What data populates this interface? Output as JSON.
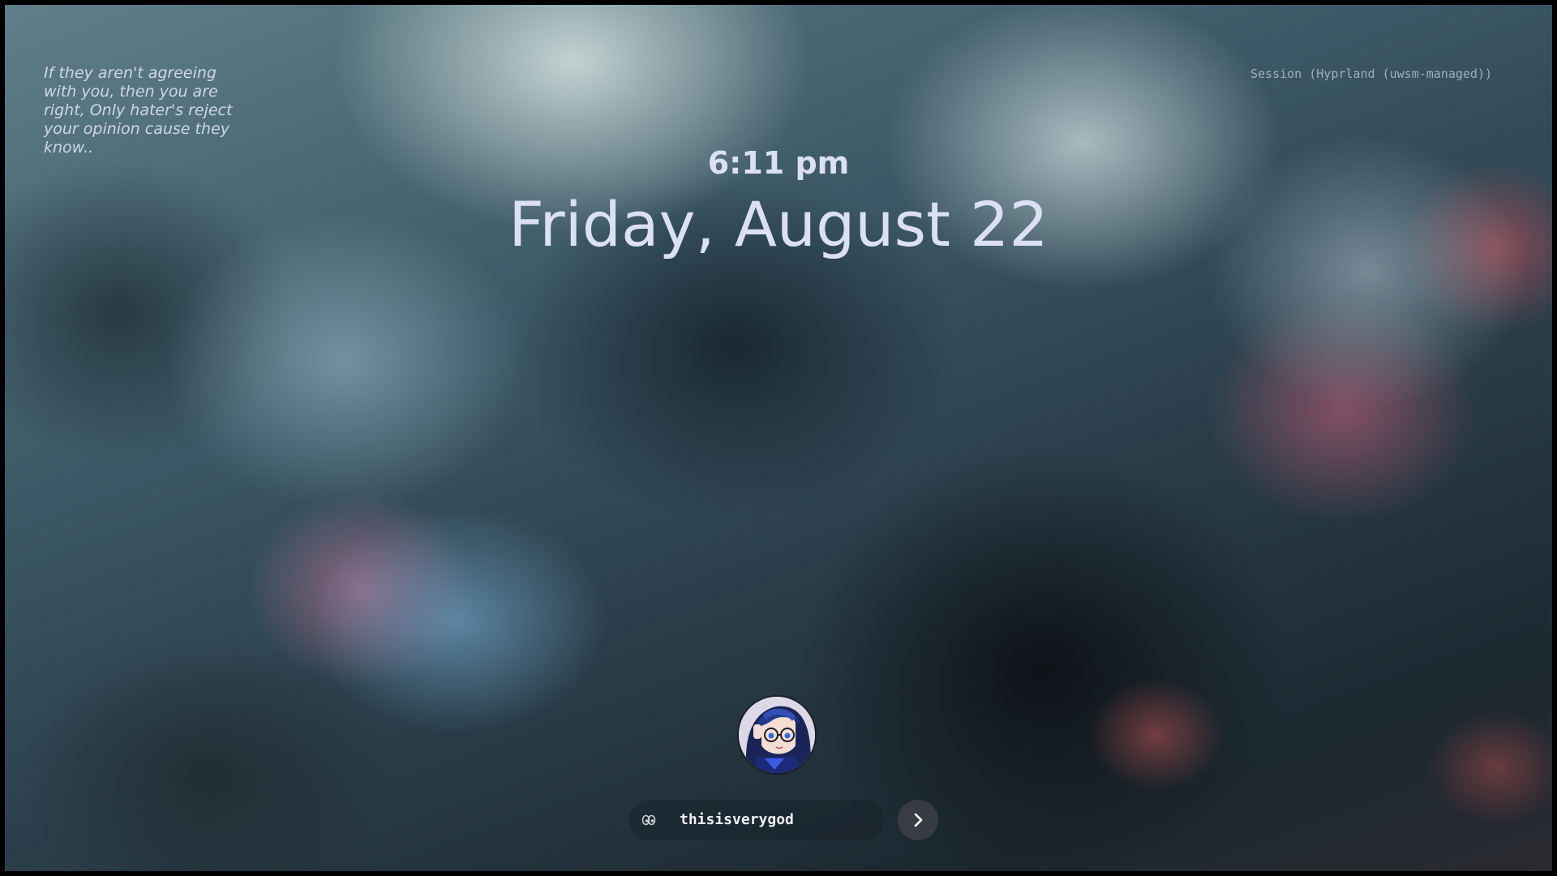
{
  "quote": {
    "text": "If they aren't agreeing with you, then you are right, Only hater's reject your opinion cause they know.."
  },
  "session": {
    "label": "Session (Hyprland (uwsm-managed))"
  },
  "clock": {
    "time": "6:11 pm",
    "date": "Friday, August 22"
  },
  "user": {
    "avatar_icon": "anime-avatar-icon",
    "username": "thisisverygod"
  },
  "icons": {
    "password_toggle": "eye-icon",
    "submit": "chevron-right-icon"
  },
  "colors": {
    "clock_text": "#dbe0f4",
    "submit_button": "#3a3e46"
  }
}
